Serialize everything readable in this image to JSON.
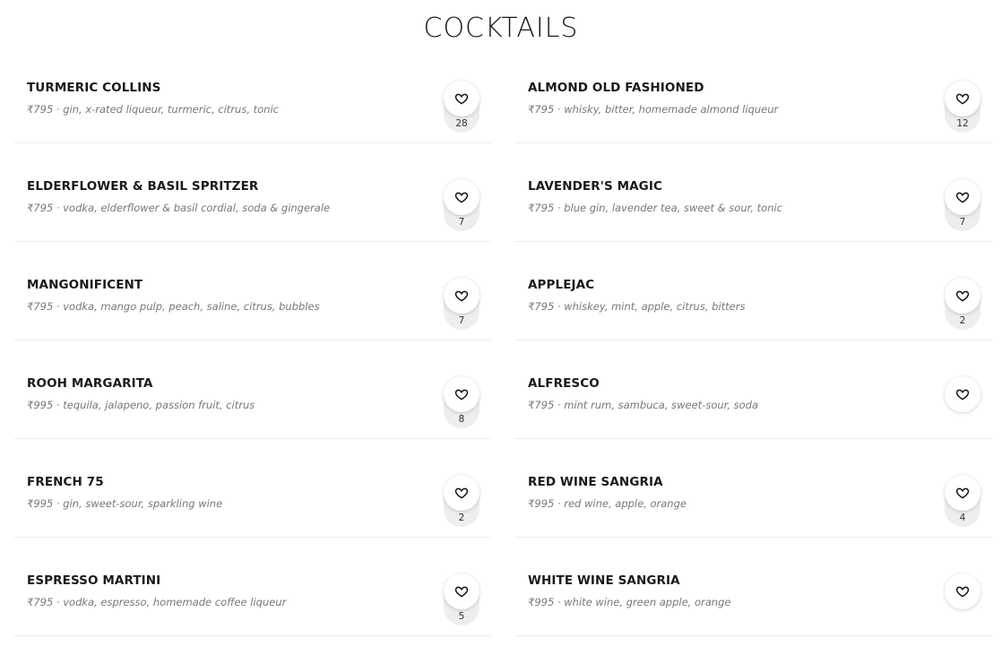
{
  "page": {
    "title": "COCKTAILS"
  },
  "menu": {
    "left": [
      {
        "name": "TURMERIC COLLINS",
        "meta": "₹795 · gin, x-rated liqueur, turmeric, citrus, tonic",
        "likes": "28"
      },
      {
        "name": "ELDERFLOWER & BASIL SPRITZER",
        "meta": "₹795 · vodka, elderflower & basil cordial, soda & gingerale",
        "likes": "7"
      },
      {
        "name": "MANGONIFICENT",
        "meta": "₹795 · vodka, mango pulp, peach, saline, citrus, bubbles",
        "likes": "7"
      },
      {
        "name": "ROOH MARGARITA",
        "meta": "₹995 · tequila, jalapeno, passion fruit, citrus",
        "likes": "8"
      },
      {
        "name": "FRENCH 75",
        "meta": "₹995 · gin, sweet-sour, sparkling wine",
        "likes": "2"
      },
      {
        "name": "ESPRESSO MARTINI",
        "meta": "₹795 · vodka, espresso, homemade coffee liqueur",
        "likes": "5"
      }
    ],
    "right": [
      {
        "name": "ALMOND OLD FASHIONED",
        "meta": "₹795 · whisky, bitter, homemade almond liqueur",
        "likes": "12"
      },
      {
        "name": "LAVENDER'S MAGIC",
        "meta": "₹795 · blue gin, lavender tea, sweet & sour, tonic",
        "likes": "7"
      },
      {
        "name": "APPLEJAC",
        "meta": "₹795 · whiskey, mint, apple, citrus, bitters",
        "likes": "2"
      },
      {
        "name": "ALFRESCO",
        "meta": "₹795 · mint rum, sambuca, sweet-sour, soda",
        "likes": ""
      },
      {
        "name": "RED WINE SANGRIA",
        "meta": "₹995 · red wine, apple, orange",
        "likes": "4"
      },
      {
        "name": "WHITE WINE SANGRIA",
        "meta": "₹995 · white wine, green apple, orange",
        "likes": ""
      }
    ]
  },
  "icons": {
    "like": "heart-outline-icon"
  },
  "colors": {
    "text": "#1a1a1a",
    "meta": "#777777",
    "count_pill": "#eeeeee",
    "divider": "#ececec"
  }
}
